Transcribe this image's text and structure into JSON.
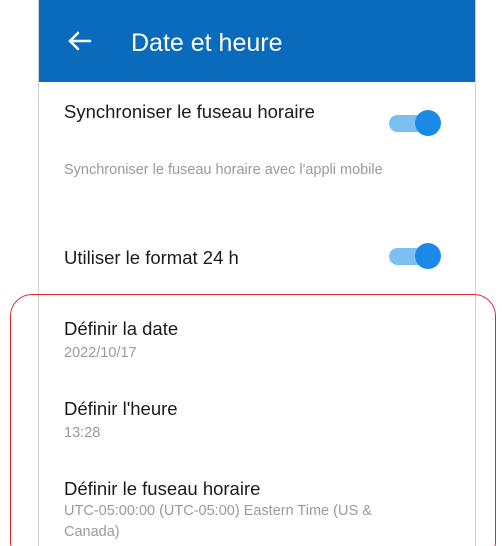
{
  "header": {
    "title": "Date et heure"
  },
  "sync_timezone": {
    "label": "Synchroniser le fuseau horaire",
    "description": "Synchroniser le fuseau horaire avec l'appli mobile",
    "enabled": true
  },
  "format_24h": {
    "label": "Utiliser le format 24 h",
    "enabled": true
  },
  "set_date": {
    "label": "Définir la date",
    "value": "2022/10/17"
  },
  "set_time": {
    "label": "Définir l'heure",
    "value": "13:28"
  },
  "set_timezone": {
    "label": "Définir le fuseau horaire",
    "value_line1": "UTC-05:00:00 (UTC-05:00) Eastern Time (US &",
    "value_line2": "Canada)"
  },
  "colors": {
    "header": "#0a6bbd",
    "toggle_track": "#7cc0f2",
    "toggle_knob": "#1a8ae6",
    "highlight": "#e4252f"
  },
  "icons": {
    "back": "arrow-left-icon"
  }
}
